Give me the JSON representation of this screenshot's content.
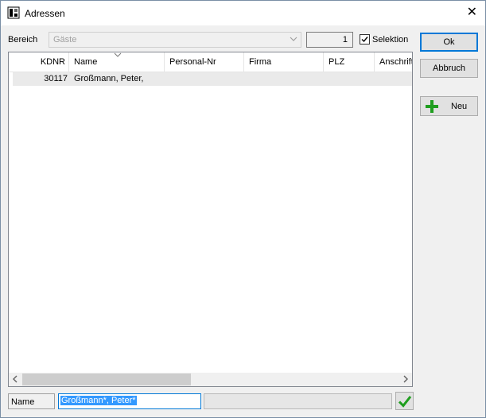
{
  "window": {
    "title": "Adressen"
  },
  "filter": {
    "bereich_label": "Bereich",
    "bereich_value": "Gäste",
    "count": "1",
    "selektion_label": "Selektion",
    "selektion_checked": true
  },
  "buttons": {
    "ok": "Ok",
    "abbruch": "Abbruch",
    "neu": "Neu"
  },
  "table": {
    "columns": [
      "KDNR",
      "Name",
      "Personal-Nr",
      "Firma",
      "PLZ",
      "Anschrift"
    ],
    "rows": [
      {
        "kdnr": "30117",
        "name": "Großmann, Peter,"
      }
    ]
  },
  "search": {
    "label": "Name",
    "value": "Großmann*, Peter*"
  }
}
